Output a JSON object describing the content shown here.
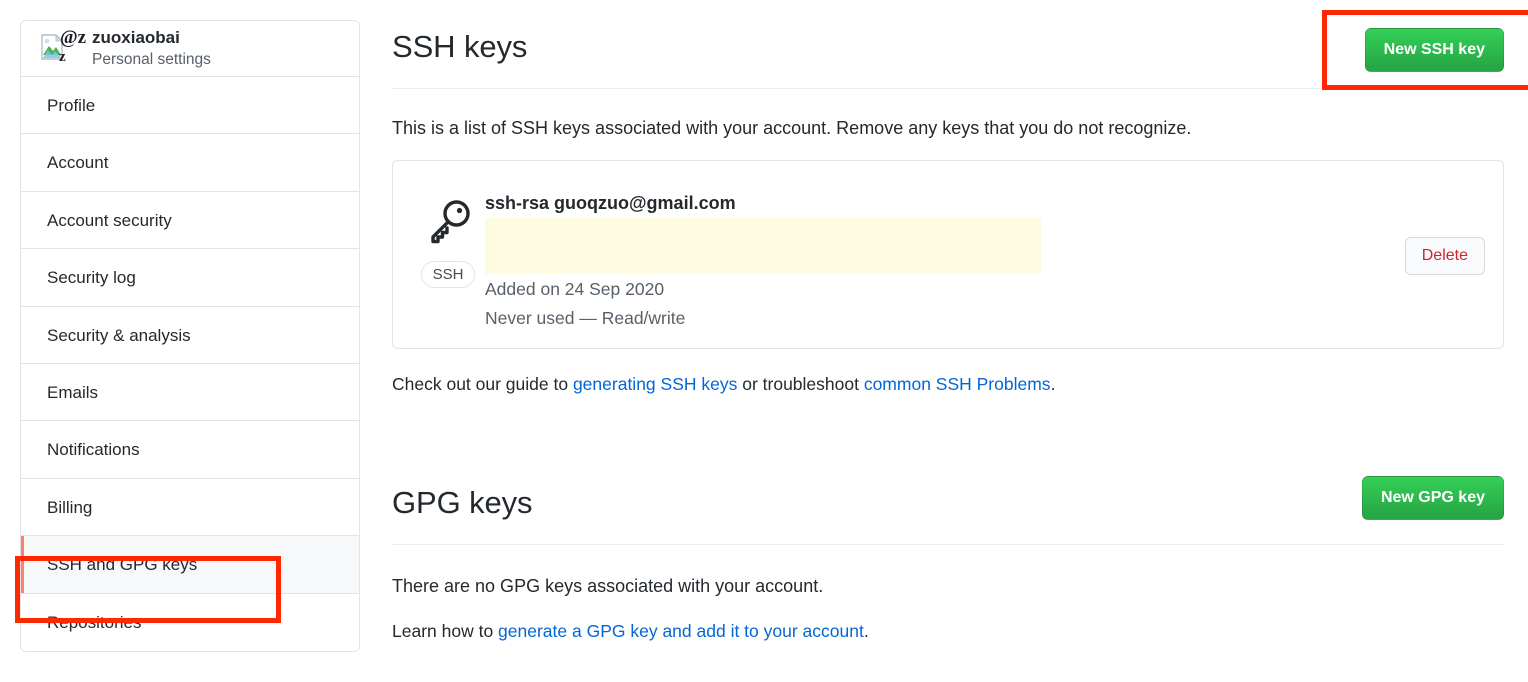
{
  "sidebar": {
    "user": {
      "avatar_alt": "@z",
      "avatar_icon": "broken-image-icon",
      "name": "zuoxiaobai",
      "subtitle": "Personal settings"
    },
    "items": [
      {
        "label": "Profile",
        "selected": false
      },
      {
        "label": "Account",
        "selected": false
      },
      {
        "label": "Account security",
        "selected": false
      },
      {
        "label": "Security log",
        "selected": false
      },
      {
        "label": "Security & analysis",
        "selected": false
      },
      {
        "label": "Emails",
        "selected": false
      },
      {
        "label": "Notifications",
        "selected": false
      },
      {
        "label": "Billing",
        "selected": false
      },
      {
        "label": "SSH and GPG keys",
        "selected": true
      },
      {
        "label": "Repositories",
        "selected": false
      }
    ]
  },
  "ssh_section": {
    "title": "SSH keys",
    "new_button": "New SSH key",
    "description": "This is a list of SSH keys associated with your account. Remove any keys that you do not recognize.",
    "key": {
      "icon": "key-icon",
      "badge": "SSH",
      "title": "ssh-rsa guoqzuo@gmail.com",
      "fingerprint_redacted": true,
      "added": "Added on 24 Sep 2020",
      "usage": "Never used — Read/write",
      "delete_button": "Delete"
    },
    "helper": {
      "prefix": "Check out our guide to ",
      "link1": "generating SSH keys",
      "middle": " or troubleshoot ",
      "link2": "common SSH Problems",
      "suffix": "."
    }
  },
  "gpg_section": {
    "title": "GPG keys",
    "new_button": "New GPG key",
    "empty_text": "There are no GPG keys associated with your account.",
    "learn": {
      "prefix": "Learn how to ",
      "link": "generate a GPG key and add it to your account",
      "suffix": "."
    }
  },
  "annotations": {
    "color": "#ff2800",
    "boxes": [
      {
        "name": "new-ssh-key-button"
      },
      {
        "name": "sidebar-item-ssh-and-gpg-keys"
      }
    ]
  },
  "colors": {
    "green_button": "#2ea44f",
    "link_blue": "#0366d6",
    "delete_red": "#cb2431",
    "selected_accent": "#f9826c",
    "redaction_yellow": "#fdfbe0"
  }
}
